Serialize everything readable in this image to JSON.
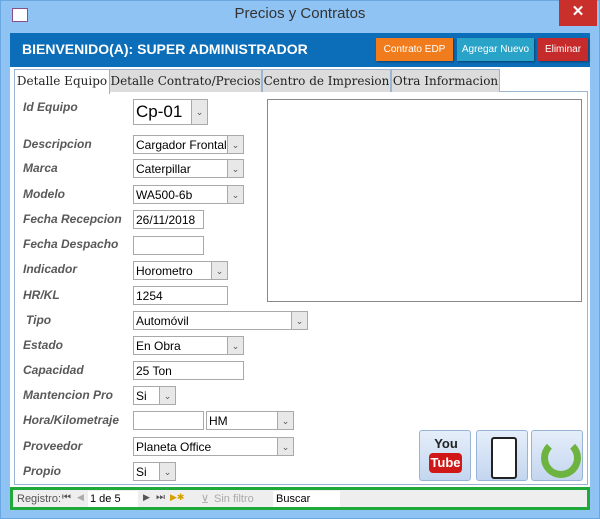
{
  "window": {
    "title": "Precios y Contratos",
    "close": "✕"
  },
  "header": {
    "welcome": "BIENVENIDO(A): SUPER ADMINISTRADOR",
    "buttons": {
      "contrato": "Contrato EDP",
      "agregar": "Agregar Nuevo",
      "eliminar": "Eliminar"
    },
    "colors": {
      "band": "#0c6db8",
      "contrato": "#f07c1e",
      "agregar": "#2aa3c8",
      "eliminar": "#c62b2b"
    }
  },
  "tabs": [
    "Detalle Equipo",
    "Detalle Contrato/Precios",
    "Centro de Impresion",
    "Otra Informacion"
  ],
  "form": {
    "id_equipo": {
      "label": "Id Equipo",
      "value": "Cp-01"
    },
    "descripcion": {
      "label": "Descripcion",
      "value": "Cargador Frontal"
    },
    "marca": {
      "label": "Marca",
      "value": "Caterpillar"
    },
    "modelo": {
      "label": "Modelo",
      "value": "WA500-6b"
    },
    "fecha_recepcion": {
      "label": "Fecha Recepcion",
      "value": "26/11/2018"
    },
    "fecha_despacho": {
      "label": "Fecha Despacho",
      "value": ""
    },
    "indicador": {
      "label": "Indicador",
      "value": "Horometro"
    },
    "hr_kl": {
      "label": "HR/KL",
      "value": "1254"
    },
    "tipo": {
      "label": "Tipo",
      "value": "Automóvil"
    },
    "estado": {
      "label": "Estado",
      "value": "En Obra"
    },
    "capacidad": {
      "label": "Capacidad",
      "value": "25 Ton"
    },
    "mantencion": {
      "label": "Mantencion Pro",
      "value": "Si"
    },
    "hora_km": {
      "label": "Hora/Kilometraje",
      "value": "",
      "unit": "HM"
    },
    "proveedor": {
      "label": "Proveedor",
      "value": "Planeta Office"
    },
    "propio": {
      "label": "Propio",
      "value": "Si"
    }
  },
  "icons": {
    "youtube": {
      "you": "You",
      "tube": "Tube"
    }
  },
  "navigation": {
    "label": "Registro:",
    "record": "1 de 5",
    "filter": "Sin filtro",
    "search": "Buscar"
  }
}
